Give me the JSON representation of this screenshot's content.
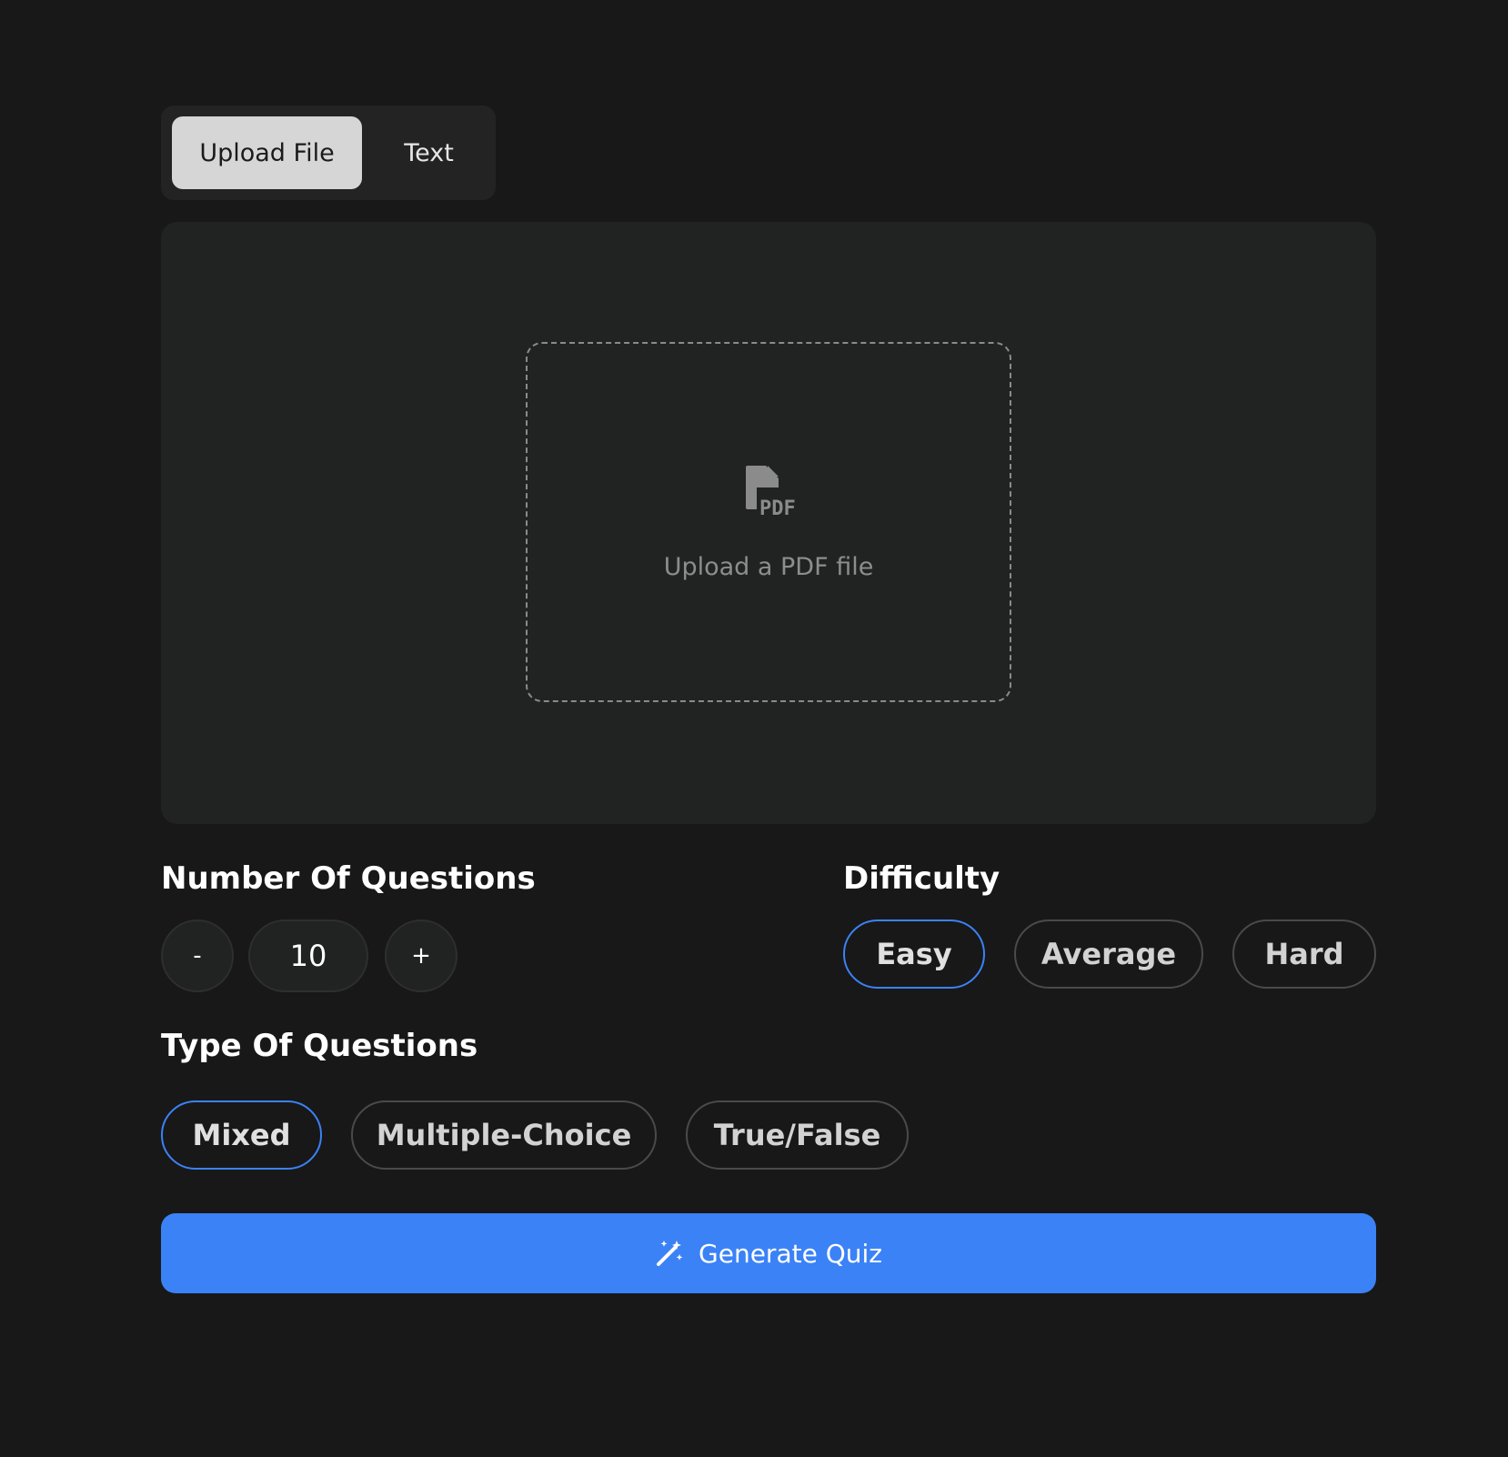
{
  "tabs": [
    {
      "label": "Upload File",
      "active": true
    },
    {
      "label": "Text",
      "active": false
    }
  ],
  "upload": {
    "icon": "pdf-file-icon",
    "label": "Upload a PDF file"
  },
  "questions_count": {
    "title": "Number Of Questions",
    "decrement_label": "-",
    "value": "10",
    "increment_label": "+"
  },
  "difficulty": {
    "title": "Difficulty",
    "options": [
      "Easy",
      "Average",
      "Hard"
    ],
    "selected": "Easy"
  },
  "question_type": {
    "title": "Type Of Questions",
    "options": [
      "Mixed",
      "Multiple-Choice",
      "True/False"
    ],
    "selected": "Mixed"
  },
  "generate": {
    "icon": "magic-wand-icon",
    "label": "Generate Quiz"
  },
  "colors": {
    "background": "#181818",
    "panel": "#212323",
    "accent": "#3b82f6",
    "active_tab": "#d6d6d6"
  }
}
